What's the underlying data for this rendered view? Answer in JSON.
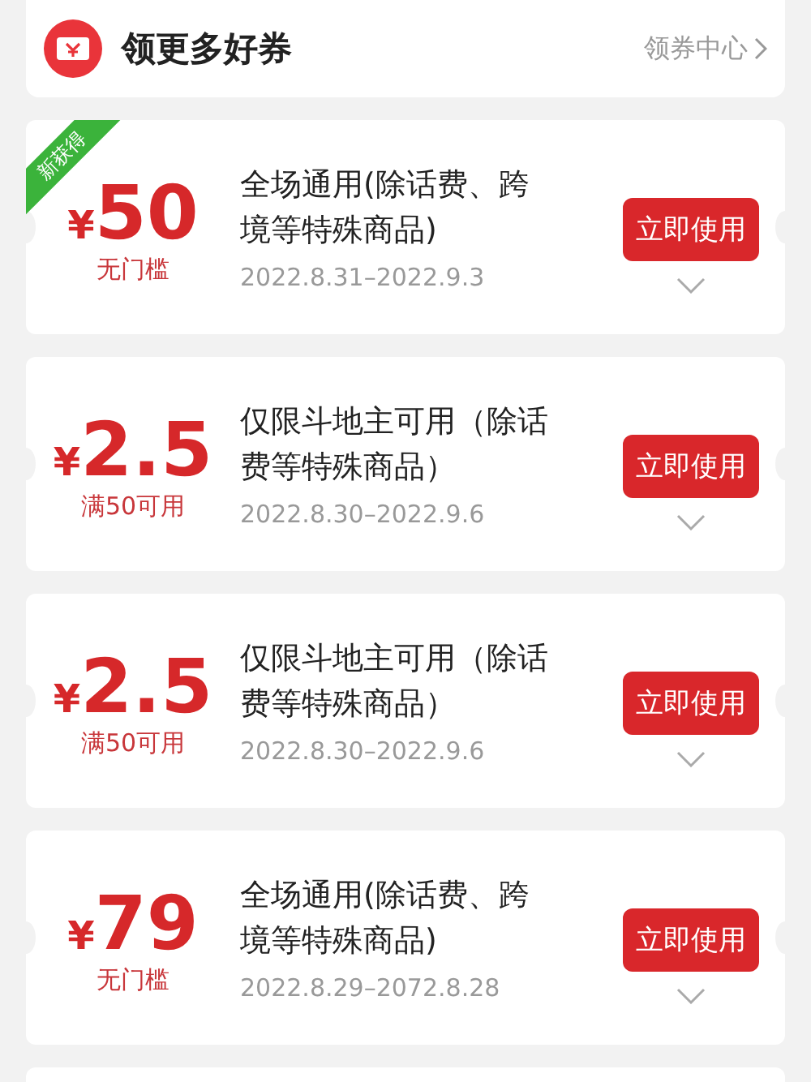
{
  "header": {
    "title": "领更多好券",
    "link": "领券中心"
  },
  "coupons": [
    {
      "badge": "新获得",
      "currency": "¥",
      "amount": "50",
      "condition": "无门槛",
      "description": "全场通用(除话费、跨境等特殊商品)",
      "validity": "2022.8.31–2022.9.3",
      "button": "立即使用"
    },
    {
      "currency": "¥",
      "amount": "2.5",
      "condition": "满50可用",
      "description": "仅限斗地主可用（除话费等特殊商品）",
      "validity": "2022.8.30–2022.9.6",
      "button": "立即使用"
    },
    {
      "currency": "¥",
      "amount": "2.5",
      "condition": "满50可用",
      "description": "仅限斗地主可用（除话费等特殊商品）",
      "validity": "2022.8.30–2022.9.6",
      "button": "立即使用"
    },
    {
      "currency": "¥",
      "amount": "79",
      "condition": "无门槛",
      "description": "全场通用(除话费、跨境等特殊商品)",
      "validity": "2022.8.29–2072.8.28",
      "button": "立即使用"
    }
  ]
}
